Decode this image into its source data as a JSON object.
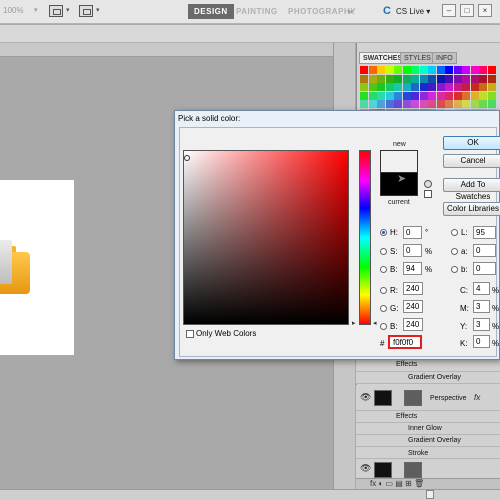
{
  "app_bar": {
    "zoom": "100%",
    "workspaces": [
      "DESIGN",
      "PAINTING",
      "PHOTOGRAPHY"
    ],
    "more": "»",
    "cs_live": "CS Live",
    "cs_live_arrow": "▾",
    "window_buttons": [
      "–",
      "□",
      "×"
    ]
  },
  "panels": {
    "tabs": [
      "SWATCHES",
      "STYLES",
      "INFO"
    ]
  },
  "layers": {
    "rows": [
      {
        "label": "Effects"
      },
      {
        "label": "Gradient Overlay"
      },
      {
        "label": "Perspective"
      },
      {
        "label": "Effects"
      },
      {
        "label": "Inner Glow"
      },
      {
        "label": "Gradient Overlay"
      },
      {
        "label": "Stroke"
      }
    ],
    "fx": "fx",
    "bottom_icons": "fx  ◐  ▭  ▤  ⊞  🗑"
  },
  "dialog": {
    "title": "Pick a solid color:",
    "new_label": "new",
    "current_label": "current",
    "buttons": {
      "ok": "OK",
      "cancel": "Cancel",
      "add": "Add To Swatches",
      "libraries": "Color Libraries"
    },
    "fields_left": [
      {
        "label": "H:",
        "value": "0",
        "unit": "°",
        "selected": true
      },
      {
        "label": "S:",
        "value": "0",
        "unit": "%",
        "selected": false
      },
      {
        "label": "B:",
        "value": "94",
        "unit": "%",
        "selected": false
      },
      {
        "label": "R:",
        "value": "240",
        "unit": "",
        "selected": false
      },
      {
        "label": "G:",
        "value": "240",
        "unit": "",
        "selected": false
      },
      {
        "label": "B:",
        "value": "240",
        "unit": "",
        "selected": false
      }
    ],
    "fields_right": [
      {
        "label": "L:",
        "value": "95",
        "unit": ""
      },
      {
        "label": "a:",
        "value": "0",
        "unit": ""
      },
      {
        "label": "b:",
        "value": "0",
        "unit": ""
      },
      {
        "label": "C:",
        "value": "4",
        "unit": "%"
      },
      {
        "label": "M:",
        "value": "3",
        "unit": "%"
      },
      {
        "label": "Y:",
        "value": "3",
        "unit": "%"
      },
      {
        "label": "K:",
        "value": "0",
        "unit": "%"
      }
    ],
    "hash": "#",
    "hex": "f0f0f0",
    "only_web_colors": "Only Web Colors",
    "new_color": "#f0f0f0",
    "current_color": "#000000"
  }
}
